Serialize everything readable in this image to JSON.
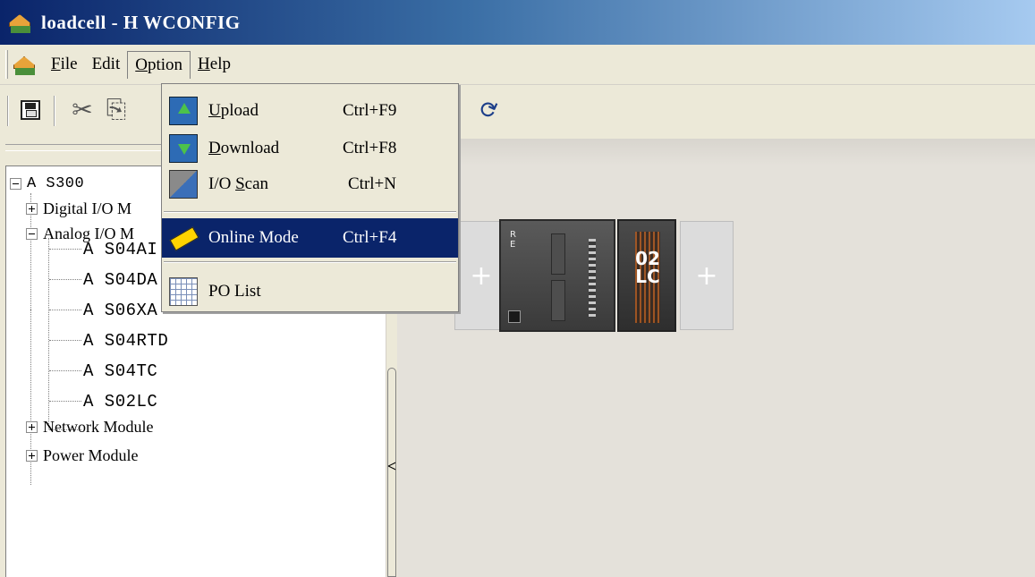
{
  "window": {
    "title": "loadcell - H WCONFIG"
  },
  "menubar": {
    "items": [
      {
        "label": "File",
        "mnemonic": "F"
      },
      {
        "label": "Edit"
      },
      {
        "label": "Option",
        "mnemonic": "O"
      },
      {
        "label": "Help",
        "mnemonic": "H"
      }
    ]
  },
  "option_menu": {
    "items": [
      {
        "label": "Upload",
        "shortcut": "Ctrl+F9",
        "icon": "upload-icon"
      },
      {
        "label": "Download",
        "shortcut": "Ctrl+F8",
        "icon": "download-icon"
      },
      {
        "label": "I/O Scan",
        "shortcut": "Ctrl+N",
        "icon": "io-scan-icon"
      },
      {
        "label": "Online Mode",
        "shortcut": "Ctrl+F4",
        "icon": "online-mode-icon",
        "highlighted": true
      },
      {
        "label": "PO List",
        "icon": "list-icon"
      }
    ]
  },
  "tree": {
    "root": "A S300",
    "groups": [
      {
        "label": "Digital I/O M",
        "expanded": false
      },
      {
        "label": "Analog I/O M",
        "expanded": true,
        "children": [
          "A S04AI",
          "A S04DA",
          "A S06XA",
          "A S04RTD",
          "A S04TC",
          "A S02LC"
        ]
      },
      {
        "label": "Network Module",
        "expanded": false
      },
      {
        "label": "Power Module",
        "expanded": false
      }
    ]
  },
  "rack": {
    "cpu_led_labels": "R\nE",
    "module_label": "02\nLC",
    "add_slot_symbol": "+"
  },
  "splitter": {
    "arrow": "<"
  },
  "colors": {
    "menu_highlight": "#0a246a",
    "titlebar": "#0a246a"
  }
}
